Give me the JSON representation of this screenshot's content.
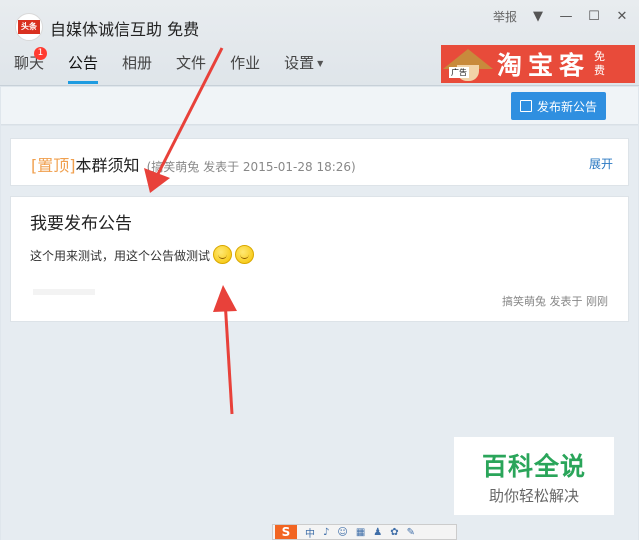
{
  "window": {
    "title": "自媒体诚信互助 免费",
    "logo_text": "头条",
    "report_label": "举报"
  },
  "tabs": [
    {
      "label": "聊天",
      "badge": "1"
    },
    {
      "label": "公告"
    },
    {
      "label": "相册"
    },
    {
      "label": "文件"
    },
    {
      "label": "作业"
    },
    {
      "label": "设置"
    }
  ],
  "ad": {
    "tag": "广告",
    "text": "淘宝客",
    "free": "免费"
  },
  "toolbar": {
    "publish_label": "发布新公告"
  },
  "pinned": {
    "tag": "[置顶]",
    "title": "本群须知",
    "meta": "(搞笑萌兔 发表于 2015-01-28 18:26)",
    "expand_label": "展开"
  },
  "post": {
    "title": "我要发布公告",
    "body": "这个用来测试，用这个公告做测试",
    "meta": "搞笑萌兔 发表于 刚刚"
  },
  "watermark": {
    "title": "百科全说",
    "subtitle": "助你轻松解决"
  },
  "bottom_bar": {
    "logo": "S",
    "icons": [
      "中",
      "♪",
      "☺",
      "▦",
      "♟",
      "✿",
      "✎"
    ]
  },
  "colors": {
    "accent": "#1e9be0",
    "button": "#2f8fe0",
    "pin_tag": "#f0a04f",
    "annotation_arrow": "#e8413a",
    "watermark_green": "#2aa55a"
  }
}
